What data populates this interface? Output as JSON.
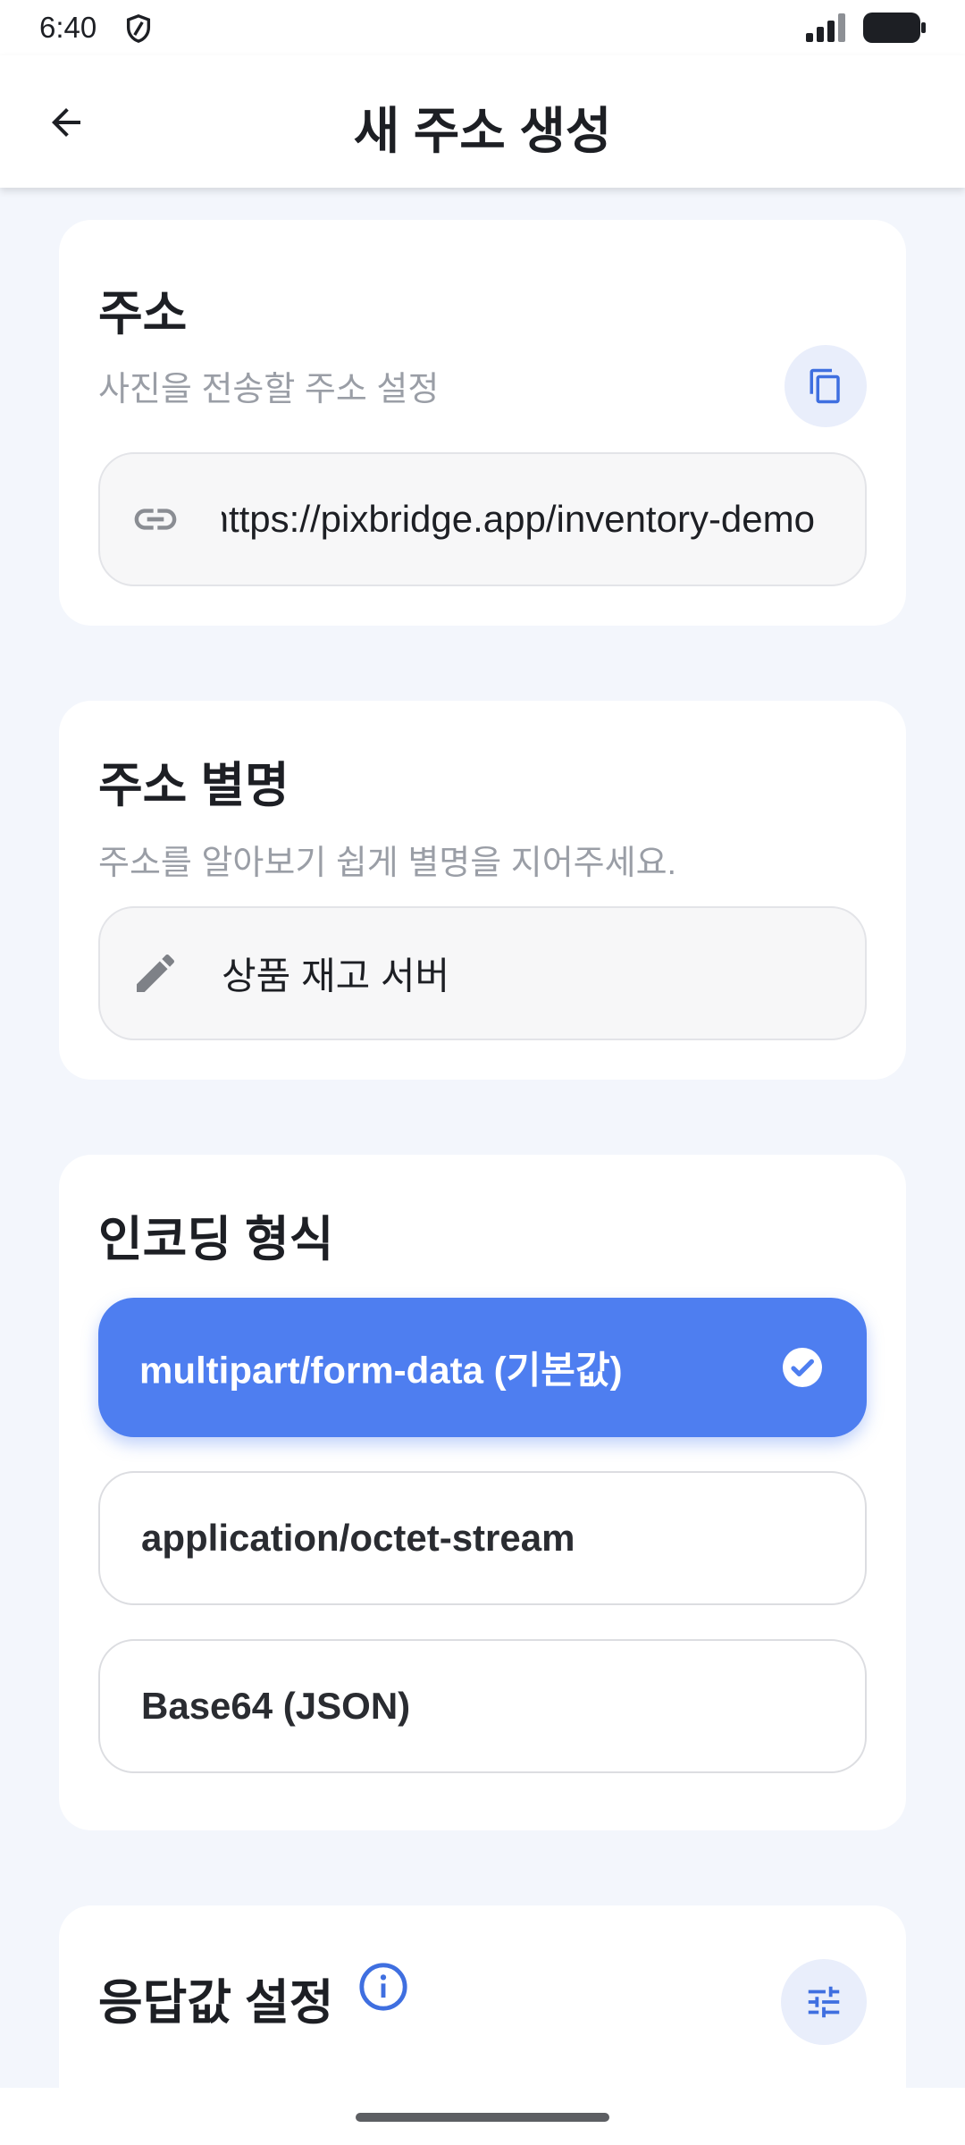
{
  "status_bar": {
    "time": "6:40"
  },
  "header": {
    "title": "새 주소 생성"
  },
  "address_card": {
    "title": "주소",
    "subtitle": "사진을 전송할 주소 설정",
    "url_value": "https://pixbridge.app/inventory-demo"
  },
  "alias_card": {
    "title": "주소 별명",
    "subtitle": "주소를 알아보기 쉽게 별명을 지어주세요.",
    "alias_value": "상품 재고 서버"
  },
  "encoding_card": {
    "title": "인코딩 형식",
    "options": [
      {
        "label": "multipart/form-data (기본값)",
        "selected": true
      },
      {
        "label": "application/octet-stream",
        "selected": false
      },
      {
        "label": "Base64 (JSON)",
        "selected": false
      }
    ]
  },
  "response_card": {
    "title": "응답값 설정"
  },
  "colors": {
    "accent": "#4e7ef0",
    "background": "#f3f6fc",
    "card": "#ffffff",
    "subtitle": "#9a9ea6"
  }
}
